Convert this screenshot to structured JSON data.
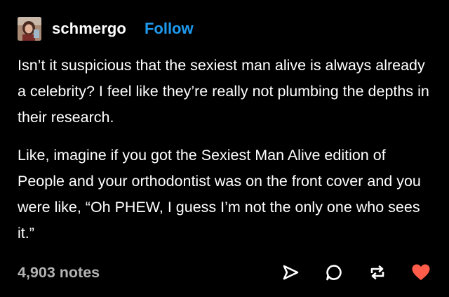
{
  "post": {
    "author": "schmergo",
    "follow_label": "Follow",
    "paragraphs": [
      "Isn’t it suspicious that the sexiest man alive is always already a celebrity? I feel like they’re really not plumbing the depths in their research.",
      "Like, imagine if you got the Sexiest Man Alive edition of People and your orthodontist was on the front cover and you were like, “Oh PHEW, I guess I’m not the only one who sees it.”"
    ],
    "notes": "4,903 notes"
  },
  "actions": [
    {
      "name": "share",
      "icon": "send-icon"
    },
    {
      "name": "reply",
      "icon": "comment-icon"
    },
    {
      "name": "reblog",
      "icon": "reblog-icon"
    },
    {
      "name": "like",
      "icon": "heart-icon",
      "color": "#ff5c4a"
    }
  ],
  "colors": {
    "background": "#000000",
    "text": "#ffffff",
    "follow": "#1e9bf0",
    "notes": "#b3b3b3",
    "like": "#ff5c4a"
  }
}
